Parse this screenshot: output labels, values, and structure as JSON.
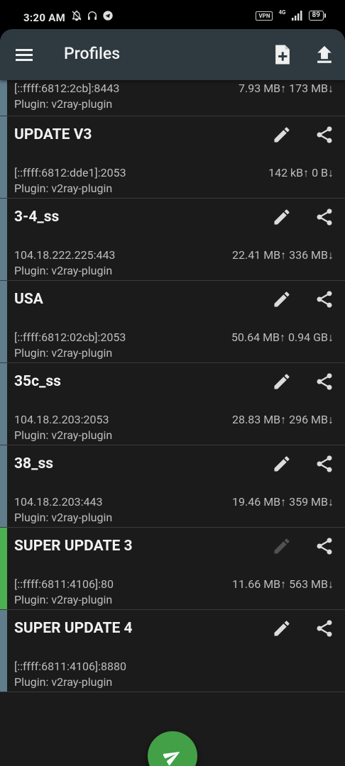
{
  "status_bar": {
    "time": "3:20 AM",
    "vpn_label": "VPN",
    "network_label": "4G",
    "battery": "89"
  },
  "app_bar": {
    "title": "Profiles"
  },
  "partial_profile": {
    "address": "[::ffff:6812:2cb]:8443",
    "plugin": "Plugin: v2ray-plugin",
    "traffic": "7.93 MB↑ 173 MB↓"
  },
  "profiles": [
    {
      "name": "UPDATE V3",
      "address": "[::ffff:6812:dde1]:2053",
      "plugin": "Plugin: v2ray-plugin",
      "traffic": "142 kB↑ 0 B↓"
    },
    {
      "name": "3-4_ss",
      "address": "104.18.222.225:443",
      "plugin": "Plugin: v2ray-plugin",
      "traffic": "22.41 MB↑ 336 MB↓"
    },
    {
      "name": "USA",
      "address": "[::ffff:6812:02cb]:2053",
      "plugin": "Plugin: v2ray-plugin",
      "traffic": "50.64 MB↑ 0.94 GB↓"
    },
    {
      "name": "35c_ss",
      "address": "104.18.2.203:2053",
      "plugin": "Plugin: v2ray-plugin",
      "traffic": "28.83 MB↑ 296 MB↓"
    },
    {
      "name": "38_ss",
      "address": "104.18.2.203:443",
      "plugin": "Plugin: v2ray-plugin",
      "traffic": "19.46 MB↑ 359 MB↓"
    },
    {
      "name": "SUPER UPDATE 3",
      "address": "[::ffff:6811:4106]:80",
      "plugin": "Plugin: v2ray-plugin",
      "traffic": "11.66 MB↑ 563 MB↓"
    },
    {
      "name": "SUPER UPDATE 4",
      "address": "[::ffff:6811:4106]:8880",
      "plugin": "Plugin: v2ray-plugin",
      "traffic": ""
    }
  ],
  "selected_profile": "SUPER UPDATE 3",
  "colors": {
    "app_bar": "#2e3a40",
    "stripe_default": "#607d8b",
    "stripe_selected": "#4caf50",
    "fab": "#43a047"
  },
  "icons": {
    "menu": "menu-icon",
    "add_profile": "file-add-icon",
    "upload": "upload-icon",
    "edit": "pencil-icon",
    "share": "share-icon",
    "connect": "send-icon"
  }
}
